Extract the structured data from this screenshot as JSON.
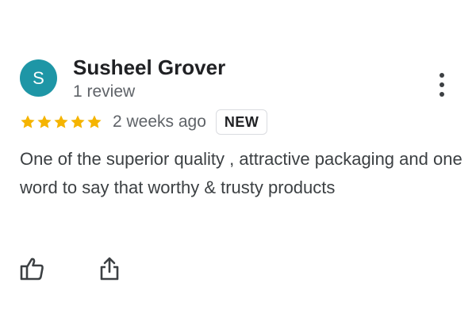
{
  "reviewer": {
    "avatar_letter": "S",
    "avatar_color": "#1e96a6",
    "name": "Susheel Grover",
    "review_count": "1 review"
  },
  "review": {
    "rating": 5,
    "rating_max": 5,
    "star_color": "#f5b400",
    "time_ago": "2 weeks ago",
    "badge": "NEW",
    "text": "One of the superior quality , attractive packaging and one word to say that worthy & trusty products"
  },
  "icons": {
    "more": "more-vert-icon",
    "like": "thumb-up-icon",
    "share": "share-icon"
  }
}
